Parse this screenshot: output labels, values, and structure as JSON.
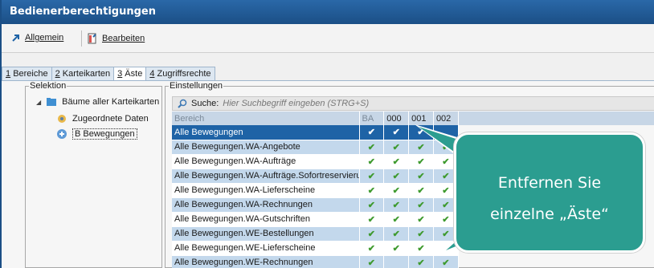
{
  "window": {
    "title": "Bedienerberechtigungen"
  },
  "toolbar": {
    "general": {
      "label": "Allgemein",
      "icon": "arrow-up-right-icon"
    },
    "edit": {
      "label": "Bearbeiten",
      "icon": "edit-document-icon"
    }
  },
  "tabs": [
    {
      "num": "1",
      "label": "Bereiche",
      "active": false
    },
    {
      "num": "2",
      "label": "Karteikarten",
      "active": false
    },
    {
      "num": "3",
      "label": "Äste",
      "active": true
    },
    {
      "num": "4",
      "label": "Zugriffsrechte",
      "active": false
    }
  ],
  "selection": {
    "title": "Selektion",
    "tree": [
      {
        "label": "Bäume aller Karteikarten",
        "icon": "tree-folder-icon",
        "expander": "◢"
      },
      {
        "label": "Zugeordnete Daten",
        "icon": "assigned-data-icon"
      },
      {
        "label": "B Bewegungen",
        "icon": "movements-icon"
      }
    ]
  },
  "settings": {
    "title": "Einstellungen",
    "search": {
      "label": "Suche:",
      "placeholder": "Hier Suchbegriff eingeben (STRG+S)"
    },
    "columns": [
      "Bereich",
      "BA",
      "000",
      "001",
      "002"
    ],
    "rows": [
      {
        "name": "Alle Bewegungen",
        "checks": [
          "✔",
          "✔",
          "✔",
          ""
        ],
        "selected": true
      },
      {
        "name": "Alle Bewegungen.WA-Angebote",
        "checks": [
          "✔",
          "✔",
          "✔",
          "✔"
        ]
      },
      {
        "name": "Alle Bewegungen.WA-Aufträge",
        "checks": [
          "✔",
          "✔",
          "✔",
          "✔"
        ]
      },
      {
        "name": "Alle Bewegungen.WA-Aufträge.Sofortreservierung",
        "checks": [
          "✔",
          "✔",
          "✔",
          "✔"
        ]
      },
      {
        "name": "Alle Bewegungen.WA-Lieferscheine",
        "checks": [
          "✔",
          "✔",
          "✔",
          "✔"
        ]
      },
      {
        "name": "Alle Bewegungen.WA-Rechnungen",
        "checks": [
          "✔",
          "✔",
          "✔",
          "✔"
        ]
      },
      {
        "name": "Alle Bewegungen.WA-Gutschriften",
        "checks": [
          "✔",
          "✔",
          "✔",
          "✔"
        ]
      },
      {
        "name": "Alle Bewegungen.WE-Bestellungen",
        "checks": [
          "✔",
          "✔",
          "✔",
          "✔"
        ]
      },
      {
        "name": "Alle Bewegungen.WE-Lieferscheine",
        "checks": [
          "✔",
          "✔",
          "✔",
          ""
        ]
      },
      {
        "name": "Alle Bewegungen.WE-Rechnungen",
        "checks": [
          "✔",
          "",
          "✔",
          "✔"
        ]
      }
    ]
  },
  "callout": {
    "line1": "Entfernen Sie",
    "line2": "einzelne „Äste“"
  },
  "colors": {
    "titlebar": "#1b4f86",
    "selection": "#1e63a6",
    "row_alt": "#c3d8ec",
    "check": "#3e9a2e",
    "callout": "#2b9d90"
  }
}
